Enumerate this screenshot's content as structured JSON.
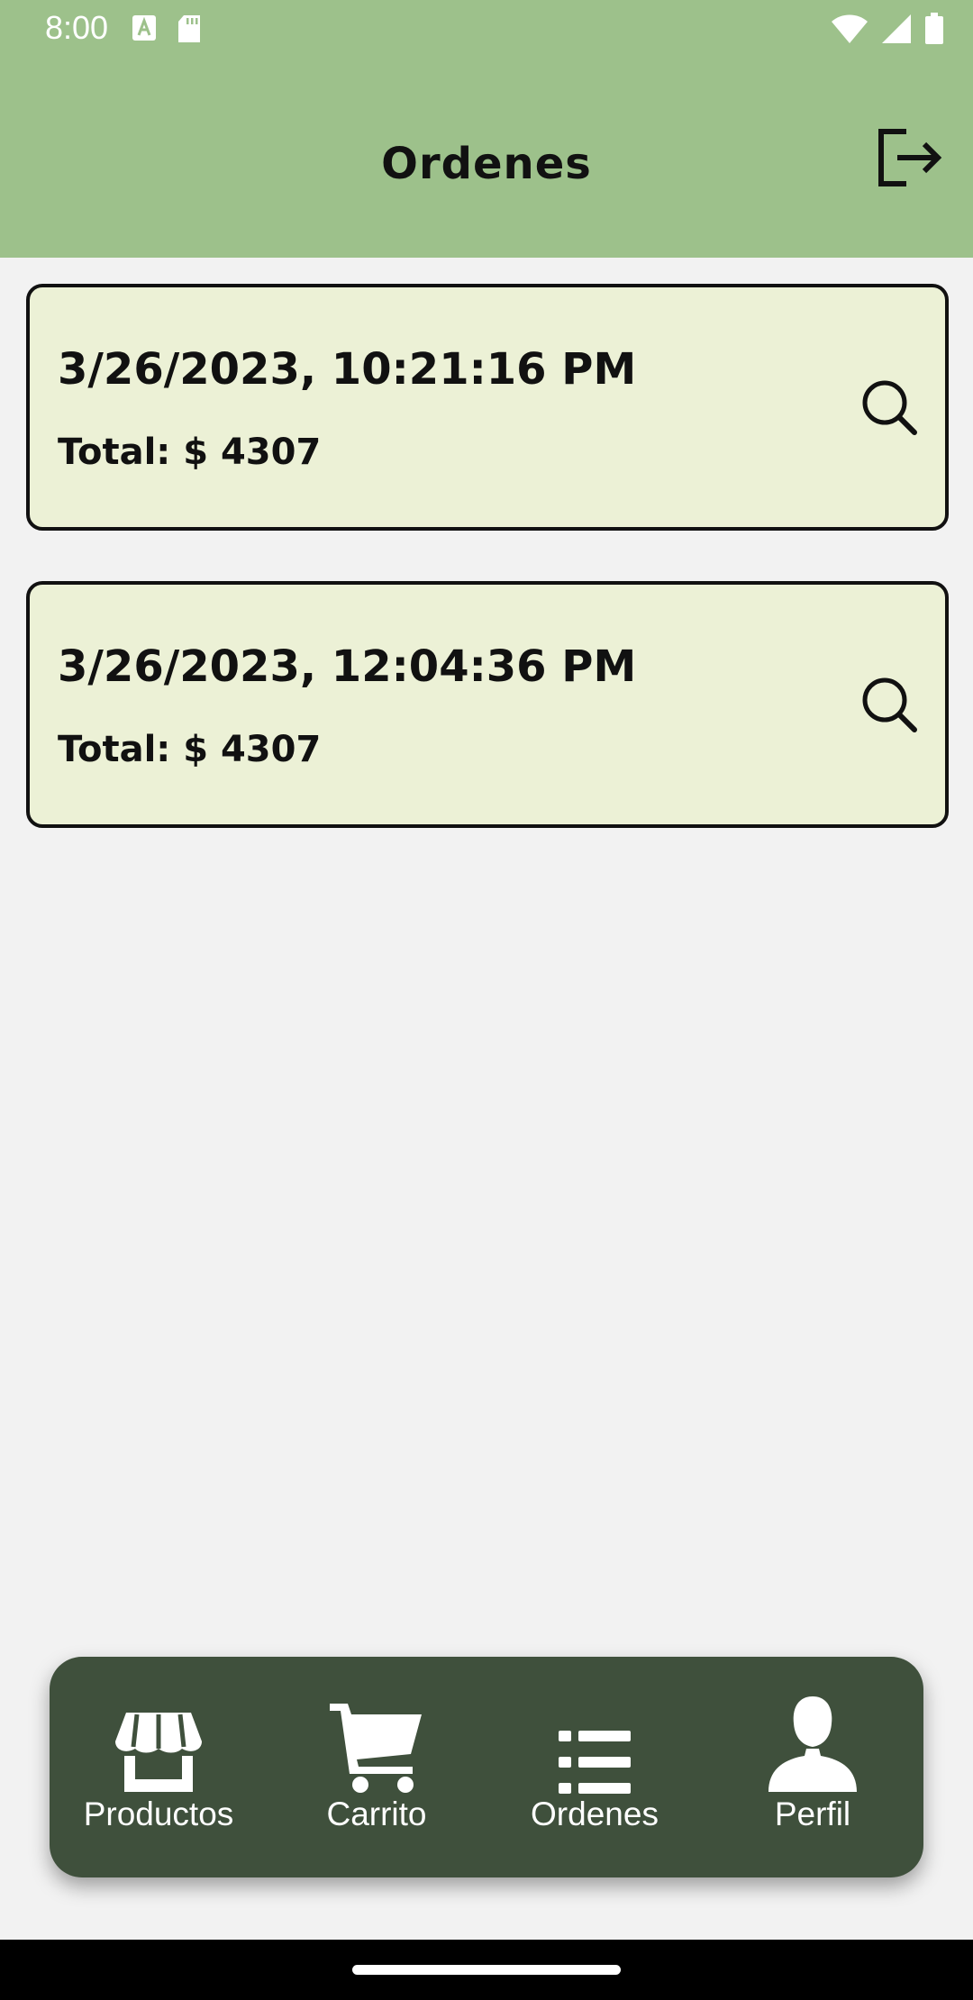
{
  "status_bar": {
    "time": "8:00",
    "left_icons": [
      "font-download-icon",
      "sd-card-icon"
    ],
    "right_icons": [
      "wifi-icon",
      "signal-icon",
      "battery-icon"
    ]
  },
  "header": {
    "title": "Ordenes",
    "action_icon": "logout-icon"
  },
  "orders": [
    {
      "date": "3/26/2023, 10:21:16 PM",
      "total": "Total: $ 4307"
    },
    {
      "date": "3/26/2023, 12:04:36 PM",
      "total": "Total: $ 4307"
    }
  ],
  "bottom_nav": {
    "items": [
      {
        "label": "Productos",
        "icon": "store-icon"
      },
      {
        "label": "Carrito",
        "icon": "cart-icon"
      },
      {
        "label": "Ordenes",
        "icon": "list-icon"
      },
      {
        "label": "Perfil",
        "icon": "user-icon"
      }
    ]
  },
  "colors": {
    "header_bg": "#9dc18b",
    "card_bg": "#ecf1d6",
    "nav_bg": "#3f503c",
    "page_bg": "#f2f2f2"
  }
}
